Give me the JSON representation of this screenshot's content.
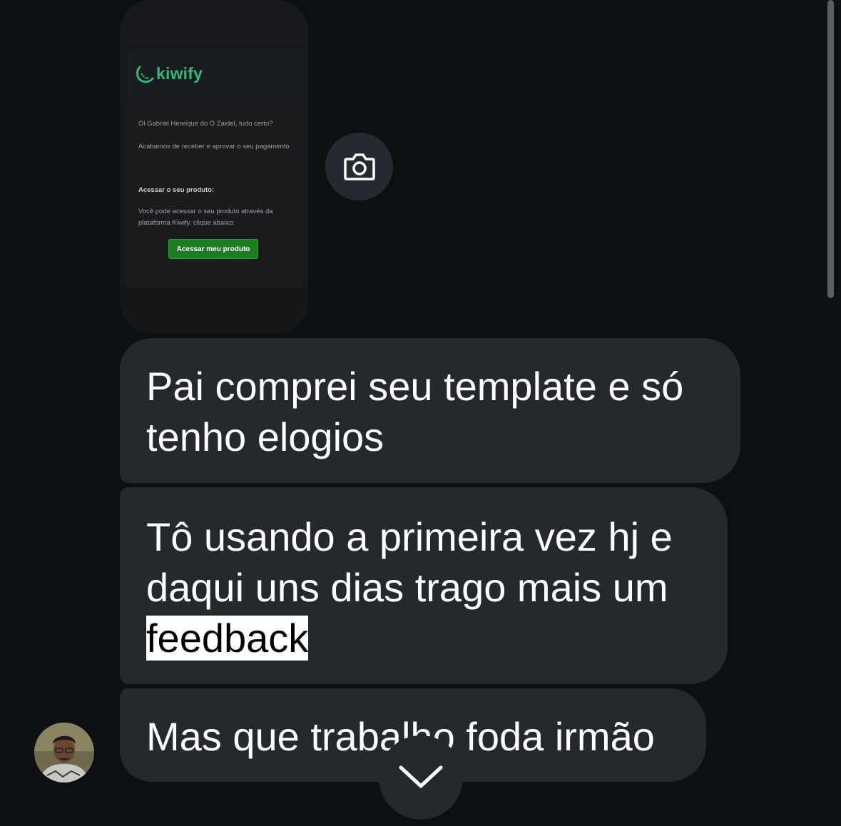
{
  "attachment": {
    "brand": "kiwify",
    "greeting": "Oi Gabriel Henrique do Ó Zaidel, tudo certo?",
    "message": "Acabamos de receber e aprovar o seu pagamento",
    "section_title": "Acessar o seu produto:",
    "section_text": "Você pode acessar o seu produto através da plataforma Kiwify, clique abaixo:",
    "cta_label": "Acessar meu produto",
    "accent_color": "#3cb575",
    "cta_color": "#1c7d23"
  },
  "messages": [
    {
      "text": "Pai comprei seu template e só tenho elogios"
    },
    {
      "text_before": "Tô usando a primeira vez hj e daqui uns dias trago mais um ",
      "highlighted": "feedback"
    },
    {
      "text": "Mas que trabalho foda irmão"
    }
  ],
  "icons": {
    "media": "camera-icon",
    "scroll": "chevron-down-icon",
    "sender": "avatar"
  },
  "colors": {
    "background": "#0c0f13",
    "bubble": "#25282d",
    "text": "#ffffff"
  }
}
